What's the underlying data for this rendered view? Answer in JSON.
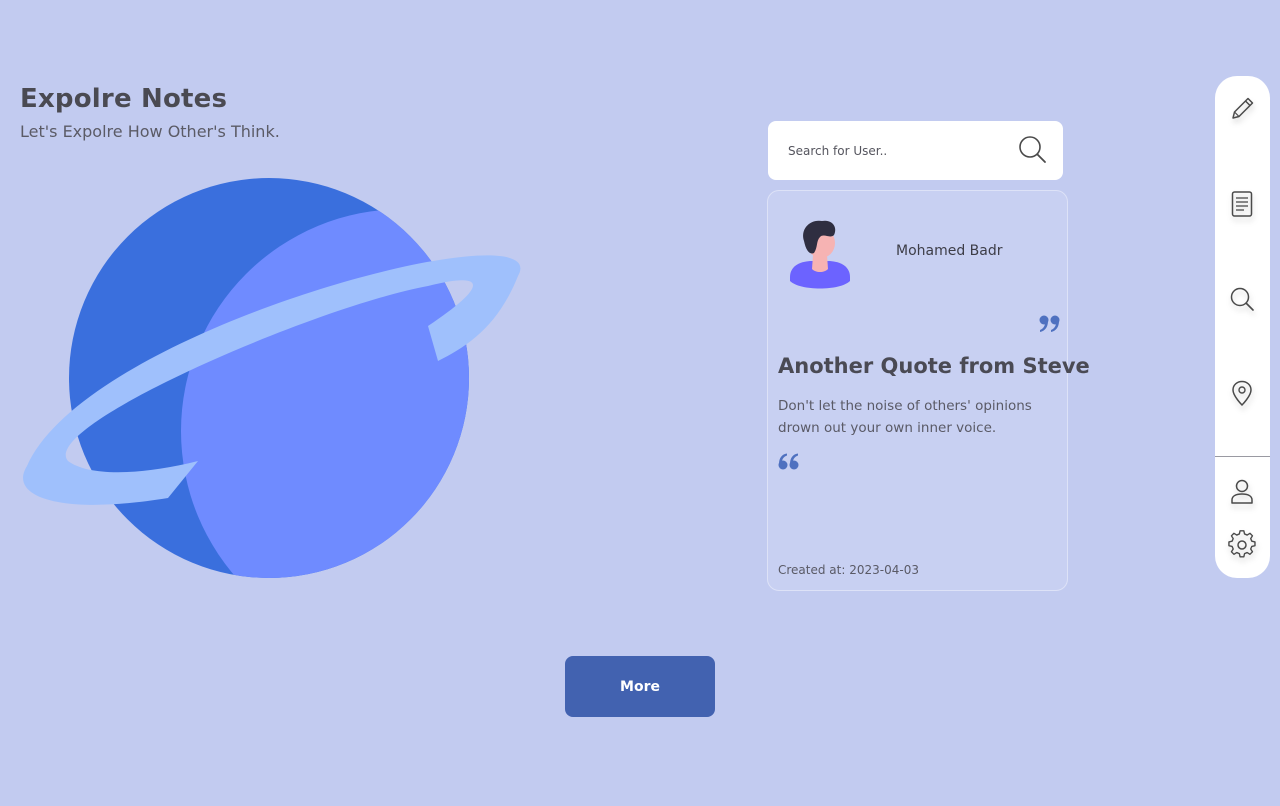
{
  "header": {
    "title": "Expolre Notes",
    "subtitle": "Let's Expolre How Other's Think."
  },
  "illustration": {
    "name": "planet-illustration",
    "colors": {
      "dark": "#3a6fdd",
      "light": "#6f8bff",
      "ring": "#9fc0fc"
    }
  },
  "search": {
    "placeholder": "Search for User..",
    "value": "",
    "icon": "search-icon"
  },
  "note": {
    "author": "Mohamed Badr",
    "title": "Another Quote from Steve",
    "body": "Don't let the noise of others' opinions drown out your own inner voice.",
    "created_label": "Created at:",
    "created_date": "2023-04-03",
    "quote_color": "#4f71c0"
  },
  "actions": {
    "more_label": "More",
    "more_color": "#4262b0"
  },
  "sidebar": {
    "items": [
      {
        "name": "pencil-icon",
        "label": "Write"
      },
      {
        "name": "notes-icon",
        "label": "Notes"
      },
      {
        "name": "search-icon",
        "label": "Search"
      },
      {
        "name": "location-icon",
        "label": "Location"
      },
      {
        "name": "user-icon",
        "label": "Profile"
      },
      {
        "name": "gear-icon",
        "label": "Settings"
      }
    ]
  },
  "colors": {
    "background": "#c2cbf0",
    "card": "#c8d0f2",
    "text": "#4a4a52"
  }
}
